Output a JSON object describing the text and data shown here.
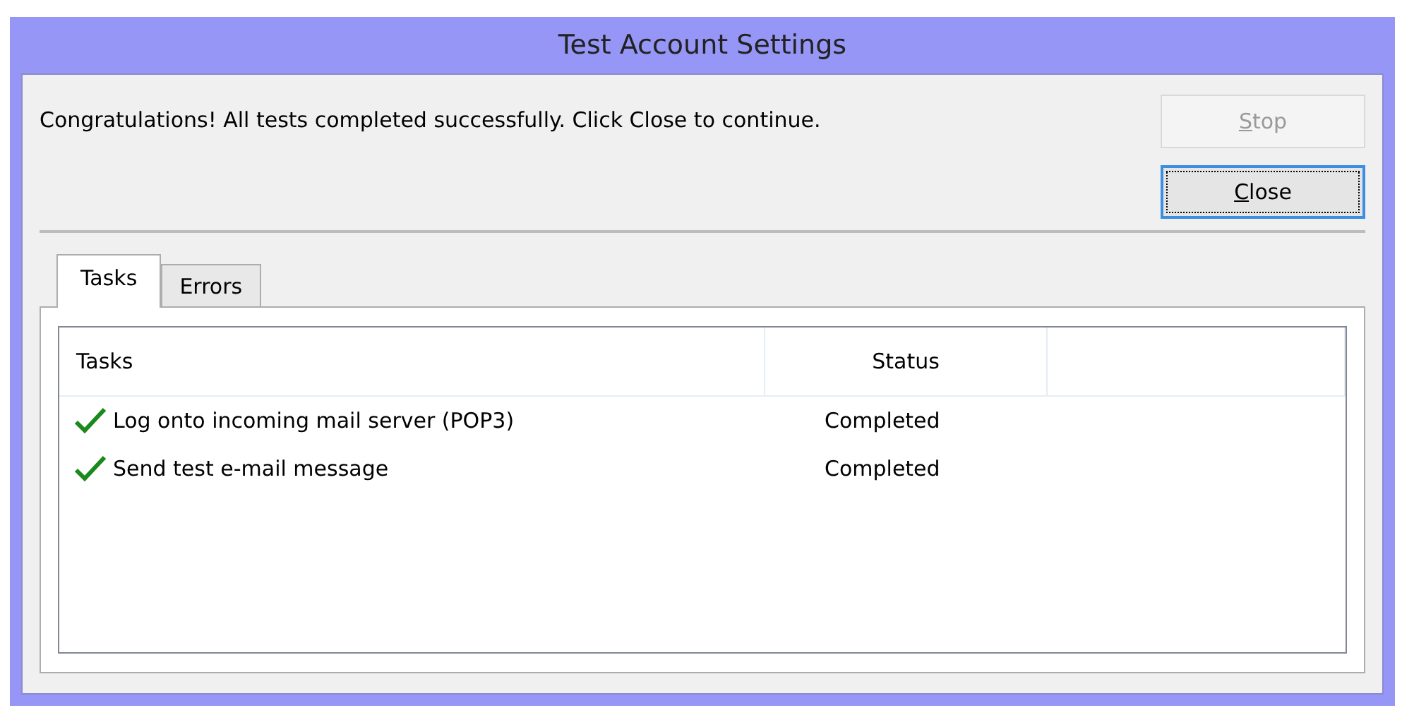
{
  "window": {
    "title": "Test Account Settings"
  },
  "message": "Congratulations! All tests completed successfully. Click Close to continue.",
  "buttons": [
    {
      "label": "Stop",
      "disabled": true,
      "focused": false
    },
    {
      "label": "Close",
      "disabled": false,
      "focused": true
    }
  ],
  "tabs": [
    {
      "label": "Tasks",
      "selected": true
    },
    {
      "label": "Errors",
      "selected": false
    }
  ],
  "table": {
    "columns": [
      "Tasks",
      "Status"
    ],
    "rows": [
      {
        "task": "Log onto incoming mail server (POP3)",
        "status": "Completed",
        "done": true
      },
      {
        "task": "Send test e-mail message",
        "status": "Completed",
        "done": true
      }
    ]
  }
}
